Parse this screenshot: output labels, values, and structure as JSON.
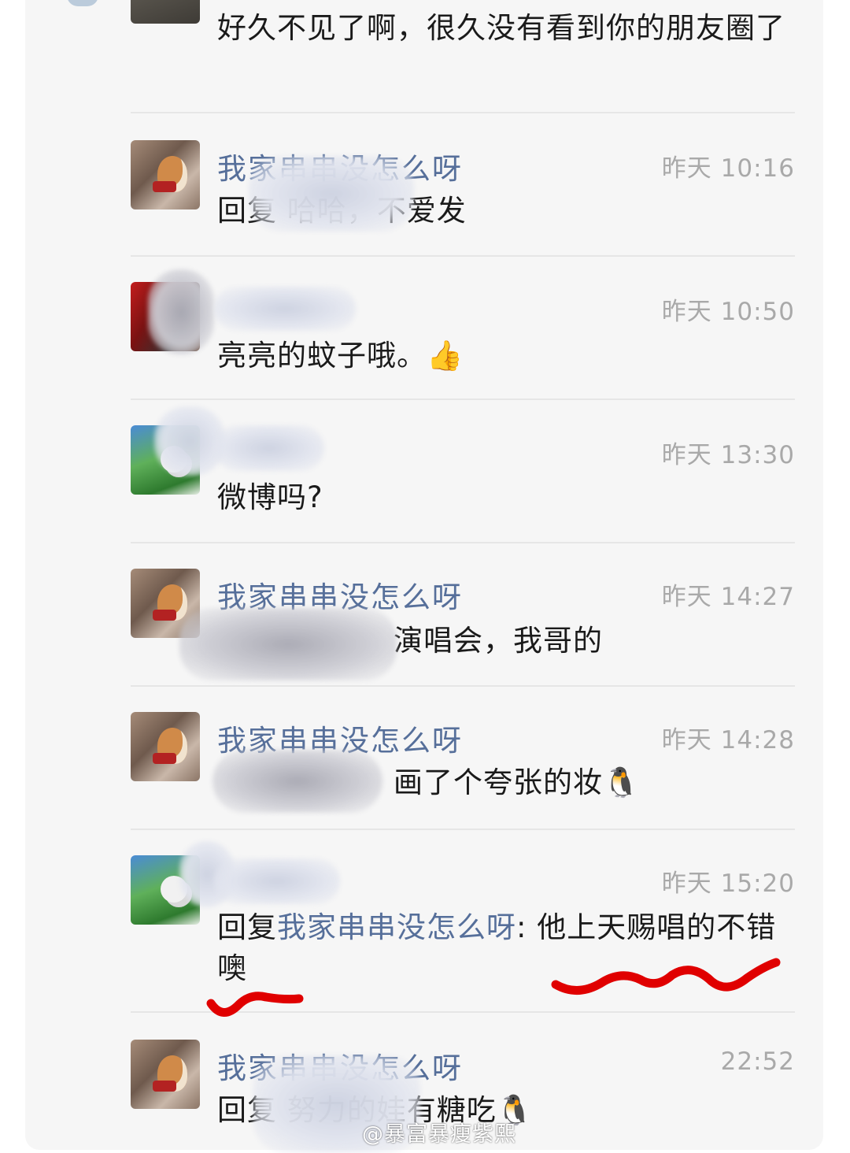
{
  "comments": [
    {
      "name": "",
      "time": "",
      "text": "好久不见了啊，很久没有看到你的朋友圈了"
    },
    {
      "name": "我家串串没怎么呀",
      "time": "昨天 10:16",
      "text": "回复 哈哈，不爱发"
    },
    {
      "name": "",
      "time": "昨天 10:50",
      "text": "亮亮的蚊子哦。👍"
    },
    {
      "name": "",
      "time": "昨天 13:30",
      "text": "微博吗?"
    },
    {
      "name": "我家串串没怎么呀",
      "time": "昨天 14:27",
      "text": "演唱会，我哥的"
    },
    {
      "name": "我家串串没怎么呀",
      "time": "昨天 14:28",
      "text": "画了个夸张的妆🐧"
    },
    {
      "name": "",
      "time": "昨天 15:20",
      "reply_prefix": "回复",
      "reply_to": "我家串串没怎么呀",
      "text": ": 他上天赐唱的不错噢"
    },
    {
      "name": "我家串串没怎么呀",
      "time": "22:52",
      "text": "回复 努力的娃有糖吃🐧"
    }
  ],
  "watermark": "@暴富暴瘦紫熙",
  "colors": {
    "name": "#566f9a",
    "time": "#a9a9a9",
    "text": "#1a1a1a",
    "annotation": "#e00000"
  }
}
